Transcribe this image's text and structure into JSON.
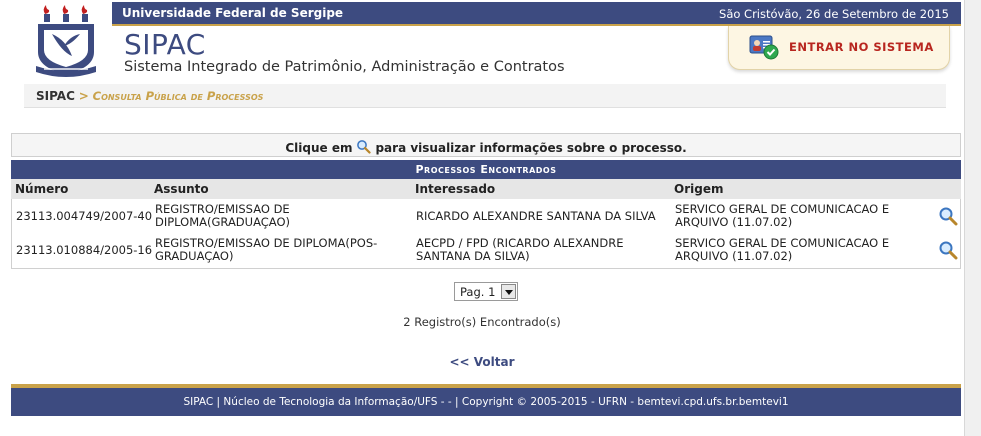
{
  "header": {
    "university": "Universidade Federal de Sergipe",
    "date": "São Cristóvão, 26 de Setembro de 2015",
    "app_title": "SIPAC",
    "app_subtitle": "Sistema Integrado de Patrimônio, Administração e Contratos",
    "login_label": "Entrar no Sistema"
  },
  "breadcrumb": {
    "home": "SIPAC",
    "separator": ">",
    "current": "Consulta Pública de Processos"
  },
  "info": {
    "prefix": "Clique em",
    "suffix": "para visualizar informações sobre o processo."
  },
  "table": {
    "caption": "Processos Encontrados",
    "headers": {
      "numero": "Número",
      "assunto": "Assunto",
      "interessado": "Interessado",
      "origem": "Origem"
    },
    "rows": [
      {
        "numero": "23113.004749/2007-40",
        "assunto": "REGISTRO/EMISSAO DE DIPLOMA(GRADUAÇAO)",
        "interessado": "RICARDO ALEXANDRE SANTANA DA SILVA",
        "origem": "SERVICO GERAL DE COMUNICACAO E ARQUIVO (11.07.02)"
      },
      {
        "numero": "23113.010884/2005-16",
        "assunto": "REGISTRO/EMISSAO DE DIPLOMA(POS-GRADUAÇAO)",
        "interessado": "AECPD / FPD (RICARDO ALEXANDRE SANTANA DA SILVA)",
        "origem": "SERVICO GERAL DE COMUNICACAO E ARQUIVO (11.07.02)"
      }
    ]
  },
  "pagination": {
    "selected": "Pag. 1",
    "count_text": "2 Registro(s) Encontrado(s)"
  },
  "back_label": "<< Voltar",
  "footer": {
    "text": "SIPAC | Núcleo de Tecnologia da Informação/UFS - - | Copyright © 2005-2015 - UFRN - bemtevi.cpd.ufs.br.bemtevi1"
  },
  "colors": {
    "primary": "#3d4b80",
    "accent": "#c9a24a",
    "login_text": "#b8261f"
  },
  "icons": {
    "view": "magnifier-icon",
    "login": "user-card-check-icon",
    "logo": "ufs-crest-logo"
  }
}
